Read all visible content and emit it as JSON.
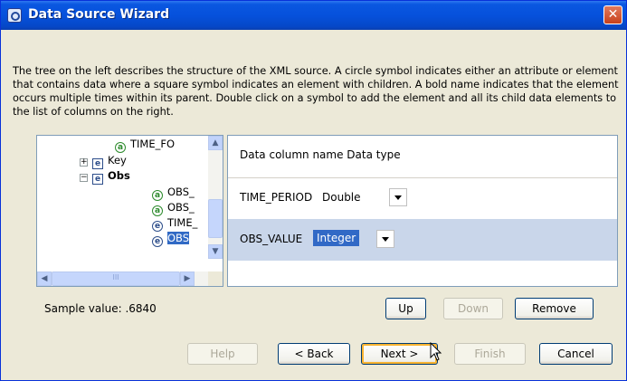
{
  "window": {
    "title": "Data Source Wizard",
    "close_glyph": "✕"
  },
  "description": "The tree on the left describes the structure of the XML source.  A circle symbol indicates either an attribute or element that contains data where a square symbol indicates an element with children.  A bold name indicates that the element occurs multiple times within its parent.  Double click on a symbol to add the element and all its child data elements to the list of columns on the right.",
  "tree": {
    "items": [
      {
        "label": "TIME_FO",
        "icon": "a"
      },
      {
        "label": "Key",
        "icon": "e",
        "expander": "+"
      },
      {
        "label": "Obs",
        "icon": "e",
        "expander": "−"
      },
      {
        "label": "OBS_",
        "icon": "a"
      },
      {
        "label": "OBS_",
        "icon": "a"
      },
      {
        "label": "TIME_",
        "icon": "e"
      },
      {
        "label": "OBS",
        "icon": "e"
      }
    ],
    "scroll_up": "▲",
    "scroll_down": "▼",
    "scroll_left": "◀",
    "scroll_right": "▶",
    "grip": "III"
  },
  "table": {
    "header": "Data column name Data type",
    "rows": [
      {
        "name": "TIME_PERIOD",
        "type": "Double"
      },
      {
        "name": "OBS_VALUE",
        "type": "Integer"
      }
    ]
  },
  "sample": "Sample value: .6840",
  "buttons": {
    "up": "Up",
    "down": "Down",
    "remove": "Remove",
    "help": "Help",
    "back": "< Back",
    "next": "Next >",
    "finish": "Finish",
    "cancel": "Cancel"
  }
}
